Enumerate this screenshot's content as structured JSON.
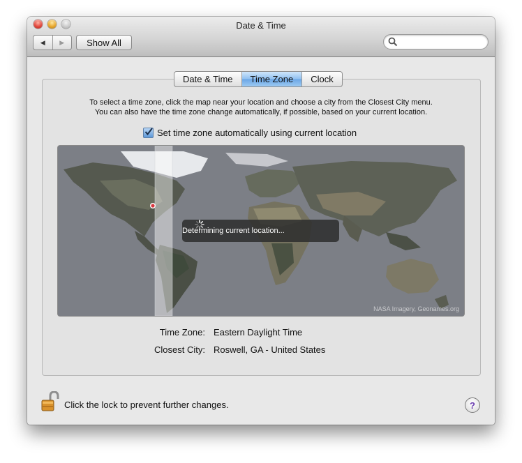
{
  "window": {
    "title": "Date & Time"
  },
  "toolbar": {
    "back_icon": "◀",
    "forward_icon": "▶",
    "show_all_label": "Show All",
    "search_placeholder": ""
  },
  "tabs": [
    {
      "label": "Date & Time",
      "active": false
    },
    {
      "label": "Time Zone",
      "active": true
    },
    {
      "label": "Clock",
      "active": false
    }
  ],
  "time_zone": {
    "instructions_line1": "To select a time zone, click the map near your location and choose a city from the Closest City menu.",
    "instructions_line2": "You can also have the time zone change automatically, if possible, based on your current location.",
    "auto_checkbox_label": "Set time zone automatically using current location",
    "auto_checked": true,
    "map_status": "Determining current location...",
    "map_credit": "NASA Imagery, Geonames.org",
    "time_zone_label": "Time Zone:",
    "time_zone_value": "Eastern Daylight Time",
    "closest_city_label": "Closest City:",
    "closest_city_value": "Roswell, GA - United States"
  },
  "footer": {
    "lock_text": "Click the lock to prevent further changes.",
    "help_label": "?"
  },
  "colors": {
    "accent_tab": "#8fbff0",
    "map_bg": "#7c7f86",
    "location_dot": "#d9363e"
  }
}
